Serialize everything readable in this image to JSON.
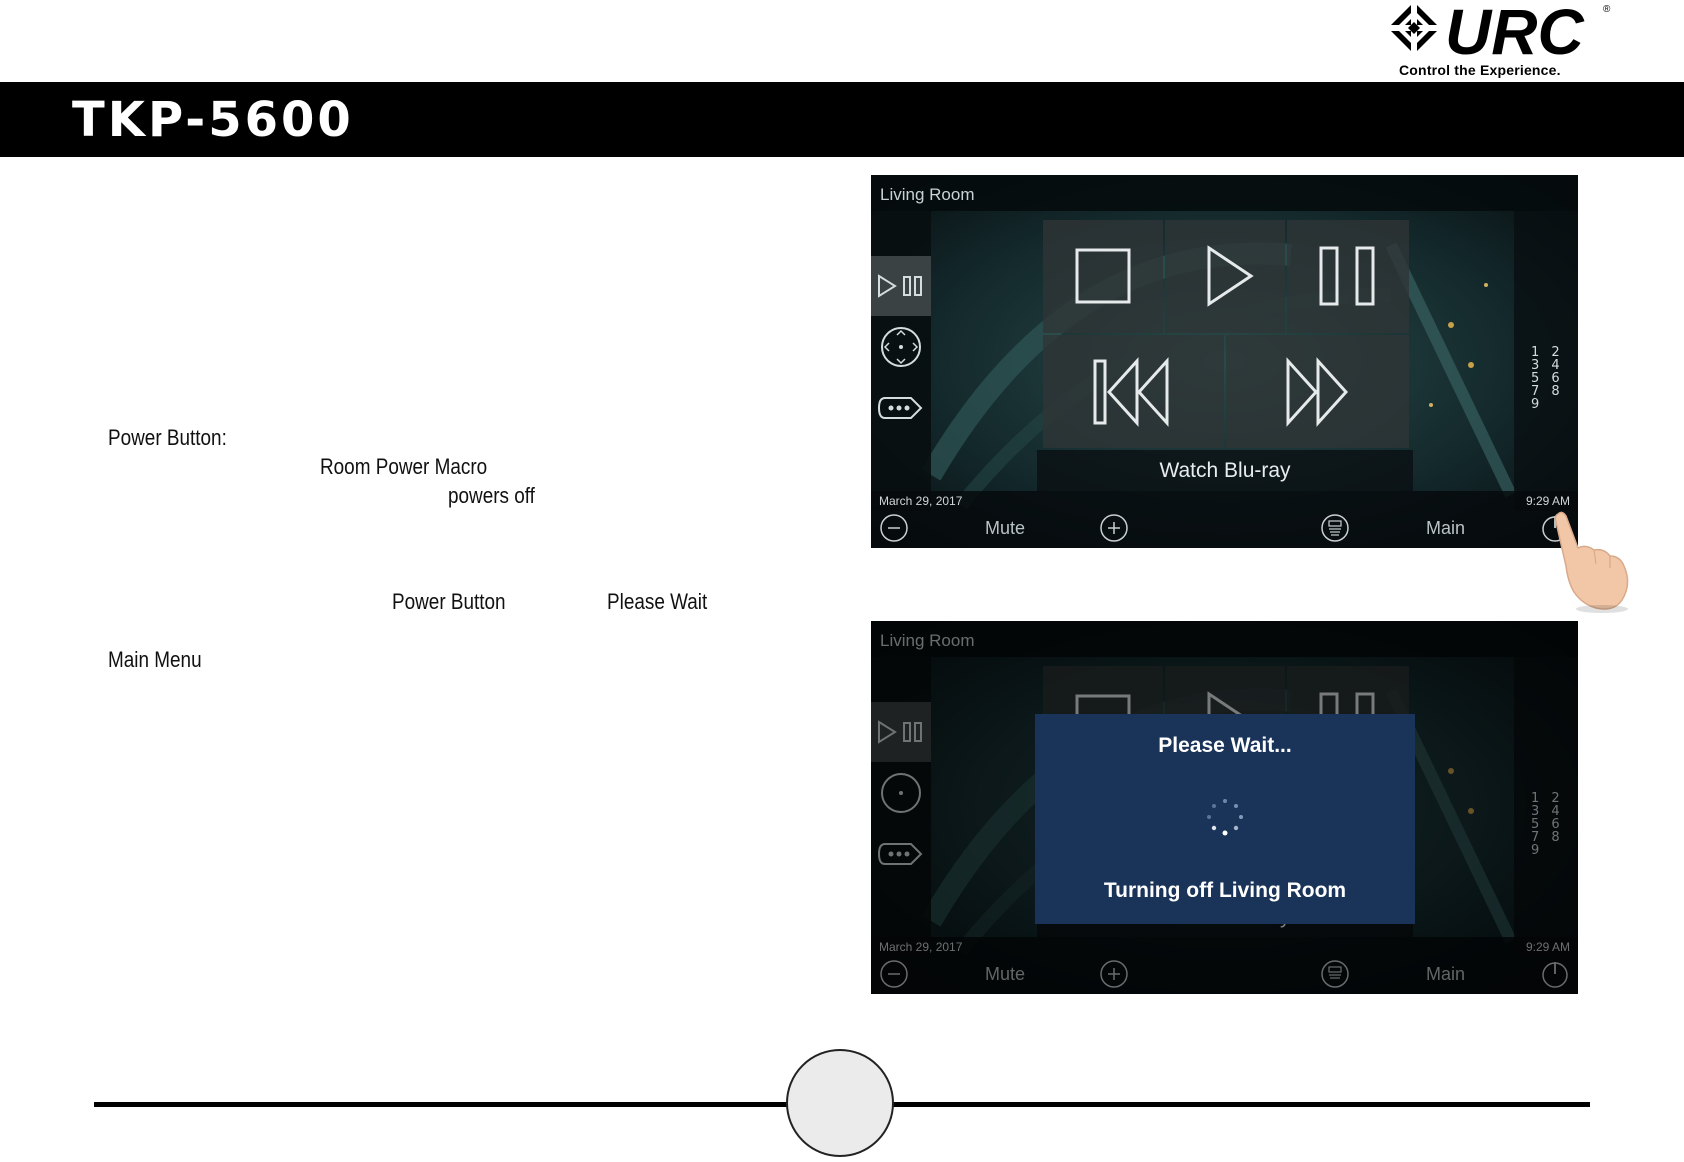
{
  "brand": {
    "logo_text": "URC",
    "tagline": "Control the Experience.",
    "registered_mark": "®"
  },
  "header": {
    "title": "TKP-5600"
  },
  "body_text": {
    "power_button_label": "Power Button:",
    "room_power_macro": "Room Power Macro",
    "powers_off": "powers off",
    "power_button_ref": "Power Button",
    "please_wait_ref": "Please Wait",
    "main_menu_ref": "Main Menu"
  },
  "screen_1": {
    "room": "Living Room",
    "activity": "Watch Blu-ray",
    "date": "March 29, 2017",
    "time": "9:29 AM",
    "mute_label": "Mute",
    "main_label": "Main",
    "keypad": "1 2 3 4 5 6 7 8 9",
    "rail_icons": [
      "transport-icon",
      "dpad-icon",
      "more-icon"
    ],
    "transport_icons": [
      "stop-icon",
      "play-icon",
      "pause-icon",
      "skip-back-icon",
      "skip-forward-icon"
    ]
  },
  "screen_2": {
    "room": "Living Room",
    "activity": "Watch Blu-ray",
    "date": "March 29, 2017",
    "time": "9:29 AM",
    "mute_label": "Mute",
    "main_label": "Main",
    "keypad": "1 2 3 4 5 6 7 8 9",
    "dialog": {
      "title": "Please Wait...",
      "message": "Turning off Living Room"
    }
  },
  "colors": {
    "title_bar": "#000000",
    "dialog_bg": "#1a3358",
    "screen_bg": "#0b1518",
    "page_circle": "#ebebeb"
  }
}
